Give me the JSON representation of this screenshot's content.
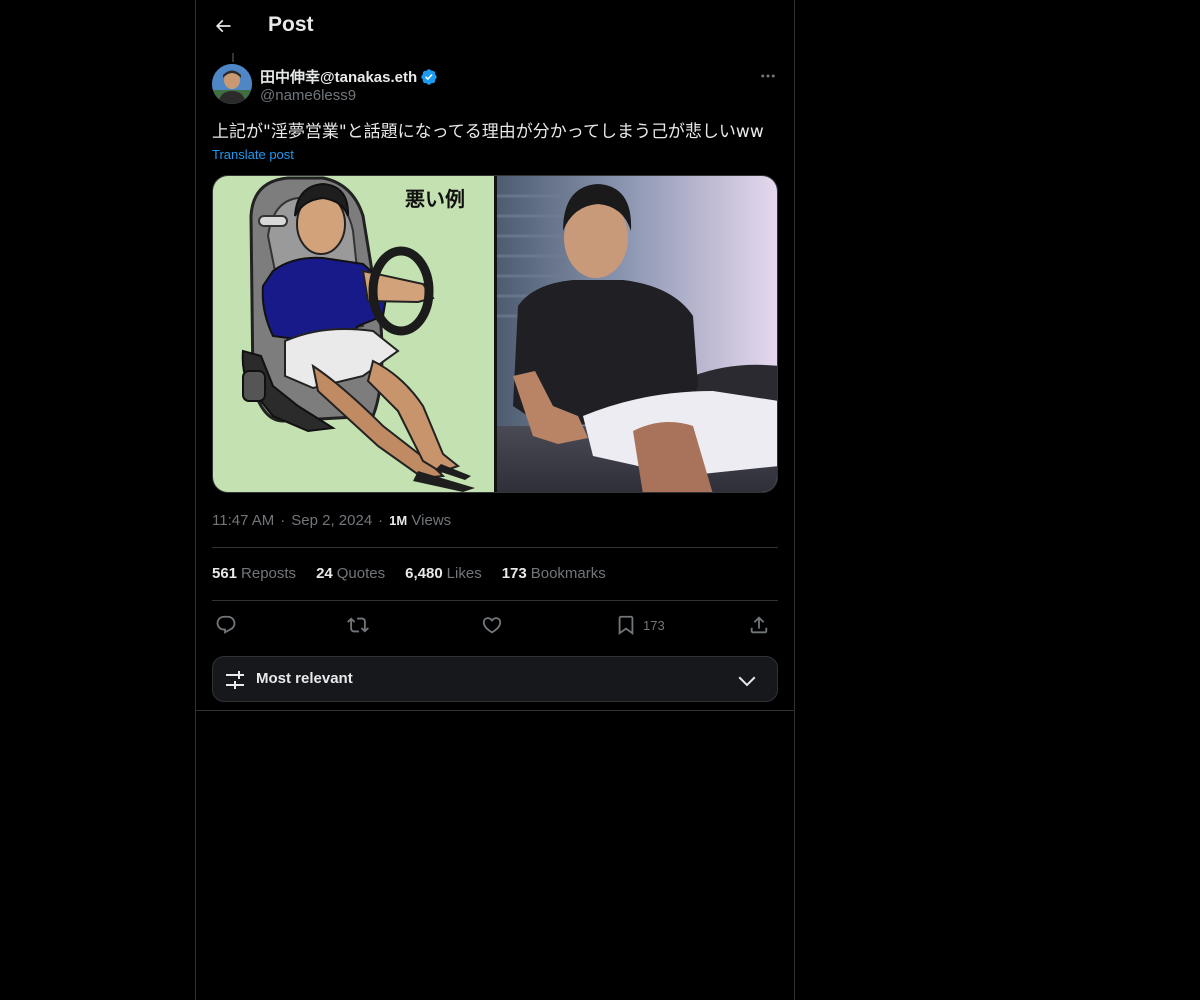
{
  "header": {
    "title": "Post",
    "back_icon": "arrow-left-icon"
  },
  "post": {
    "author": {
      "display_name": "田中伸幸@tanakas.eth",
      "handle": "@name6less9",
      "verified": true,
      "verified_color": "#1d9bf0",
      "avatar_icon": "avatar-photo"
    },
    "more_icon": "more-dots-icon",
    "text": "上記が\"淫夢営業\"と話題になってる理由が分かってしまう己が悲しいww",
    "translate_label": "Translate post",
    "media": {
      "left_caption": "悪い例",
      "description_icon": "image-icon"
    },
    "time": "11:47 AM",
    "date": "Sep 2, 2024",
    "separator": "·",
    "views_count": "1M",
    "views_label": "Views"
  },
  "stats": {
    "reposts": {
      "count": "561",
      "label": "Reposts"
    },
    "quotes": {
      "count": "24",
      "label": "Quotes"
    },
    "likes": {
      "count": "6,480",
      "label": "Likes"
    },
    "bookmarks": {
      "count": "173",
      "label": "Bookmarks"
    }
  },
  "actions": {
    "reply_icon": "reply-icon",
    "repost_icon": "repost-icon",
    "like_icon": "heart-icon",
    "bookmark_icon": "bookmark-icon",
    "bookmark_count": "173",
    "share_icon": "share-icon"
  },
  "replies_sort": {
    "label": "Most relevant",
    "icon": "sliders-icon",
    "chevron": "chevron-down-icon"
  },
  "colors": {
    "background": "#000000",
    "text_primary": "#e7e9ea",
    "text_secondary": "#71767b",
    "link": "#1d9bf0",
    "border": "#2f3336"
  }
}
